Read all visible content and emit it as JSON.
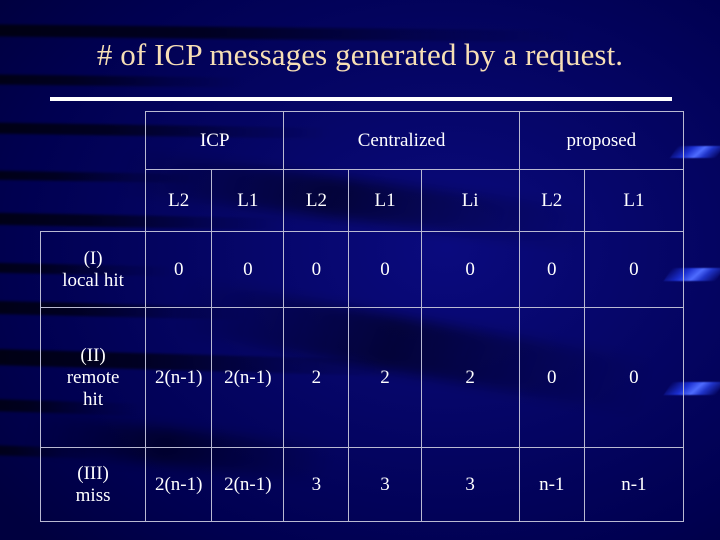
{
  "slide": {
    "title": "# of ICP messages generated by a request.",
    "background_color": "#00005e",
    "title_color": "#f7dfb5",
    "grid_color": "#b9b9d2",
    "text_color": "#ffffff",
    "accent_ribbon_color": "#4f6cff"
  },
  "table": {
    "group_headers": [
      {
        "label": "",
        "span": 1,
        "bordered": false
      },
      {
        "label": "ICP",
        "span": 2,
        "bordered": true
      },
      {
        "label": "Centralized",
        "span": 3,
        "bordered": true
      },
      {
        "label": "proposed",
        "span": 2,
        "bordered": true
      }
    ],
    "sub_headers": [
      {
        "label": "",
        "bordered": false
      },
      {
        "label": "L2",
        "bordered": true
      },
      {
        "label": "L1",
        "bordered": true
      },
      {
        "label": "L2",
        "bordered": true
      },
      {
        "label": "L1",
        "bordered": true
      },
      {
        "label": "Li",
        "bordered": true
      },
      {
        "label": "L2",
        "bordered": true
      },
      {
        "label": "L1",
        "bordered": true
      }
    ],
    "rows": [
      {
        "label_line1": "(I)",
        "label_line2": "local hit",
        "label_line3": "",
        "values": [
          "0",
          "0",
          "0",
          "0",
          "0",
          "0",
          "0"
        ]
      },
      {
        "label_line1": "(II)",
        "label_line2": "remote",
        "label_line3": "hit",
        "values": [
          "2(n-1)",
          "2(n-1)",
          "2",
          "2",
          "2",
          "0",
          "0"
        ]
      },
      {
        "label_line1": "(III)",
        "label_line2": "miss",
        "label_line3": "",
        "values": [
          "2(n-1)",
          "2(n-1)",
          "3",
          "3",
          "3",
          "n-1",
          "n-1"
        ]
      }
    ]
  }
}
